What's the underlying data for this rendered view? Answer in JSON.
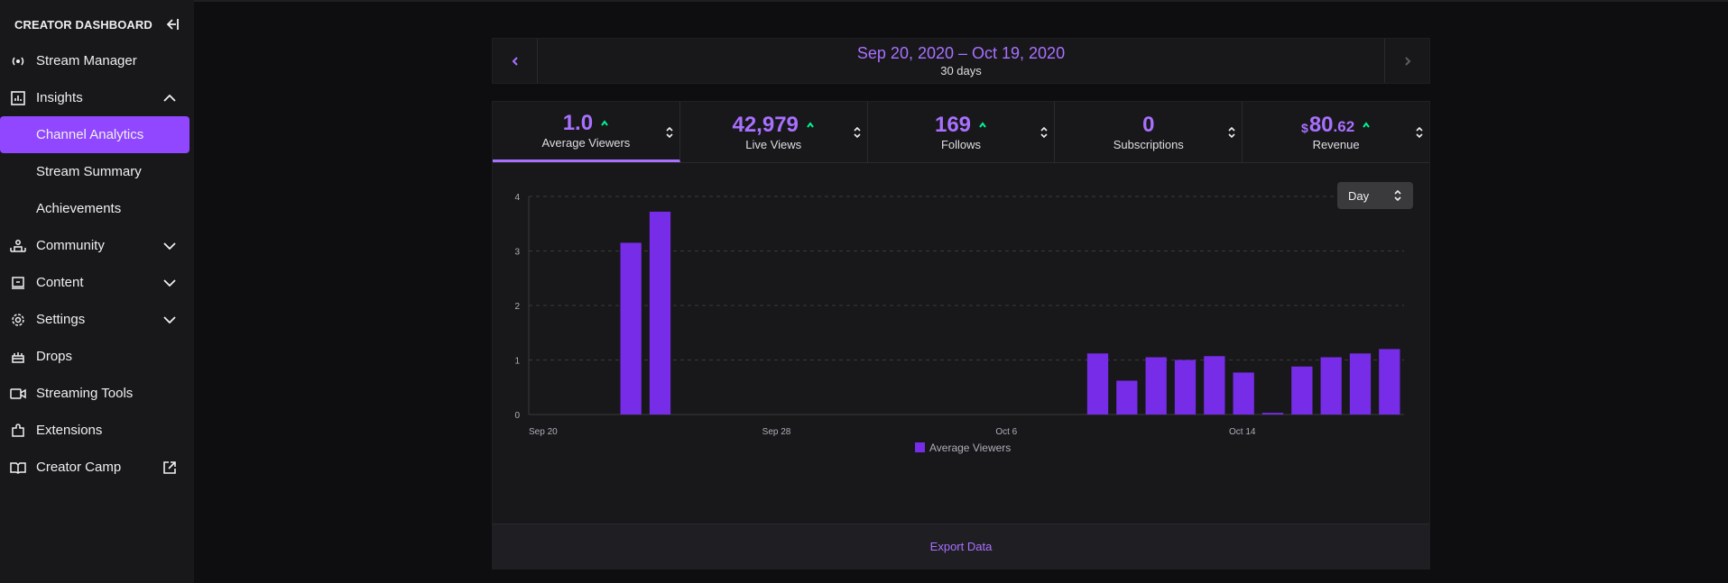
{
  "sidebar": {
    "title": "CREATOR DASHBOARD",
    "items": [
      {
        "label": "Stream Manager",
        "icon": "broadcast-icon"
      },
      {
        "label": "Insights",
        "icon": "insights-icon",
        "chevron": "up"
      },
      {
        "label": "Channel Analytics",
        "sub": true,
        "active": true
      },
      {
        "label": "Stream Summary",
        "sub": true
      },
      {
        "label": "Achievements",
        "sub": true
      },
      {
        "label": "Community",
        "icon": "community-icon",
        "chevron": "down"
      },
      {
        "label": "Content",
        "icon": "content-icon",
        "chevron": "down"
      },
      {
        "label": "Settings",
        "icon": "settings-icon",
        "chevron": "down"
      },
      {
        "label": "Drops",
        "icon": "drops-icon"
      },
      {
        "label": "Streaming Tools",
        "icon": "streaming-tools-icon"
      },
      {
        "label": "Extensions",
        "icon": "extensions-icon"
      },
      {
        "label": "Creator Camp",
        "icon": "creator-camp-icon",
        "external": true
      }
    ]
  },
  "date_range": {
    "label": "Sep 20, 2020 – Oct 19, 2020",
    "days": "30 days"
  },
  "stats": [
    {
      "value": "1.0",
      "label": "Average Viewers",
      "active": true
    },
    {
      "value": "42,979",
      "label": "Live Views"
    },
    {
      "value": "169",
      "label": "Follows"
    },
    {
      "value": "0",
      "label": "Subscriptions",
      "no_arrow": true
    },
    {
      "currency": "$",
      "value": "80",
      "cents": ".62",
      "label": "Revenue"
    }
  ],
  "granularity": "Day",
  "export_label": "Export Data",
  "colors": {
    "accent": "#a970ff",
    "bar": "#772ce8",
    "trend_up": "#00f593",
    "active_nav": "#9147ff"
  },
  "chart_data": {
    "type": "bar",
    "x": [
      "Sep 20",
      "Sep 21",
      "Sep 22",
      "Sep 23",
      "Sep 24",
      "Sep 25",
      "Sep 26",
      "Sep 27",
      "Sep 28",
      "Sep 29",
      "Sep 30",
      "Oct 1",
      "Oct 2",
      "Oct 3",
      "Oct 4",
      "Oct 5",
      "Oct 6",
      "Oct 7",
      "Oct 8",
      "Oct 9",
      "Oct 10",
      "Oct 11",
      "Oct 12",
      "Oct 13",
      "Oct 14",
      "Oct 15",
      "Oct 16",
      "Oct 17",
      "Oct 18",
      "Oct 19"
    ],
    "series": [
      {
        "name": "Average Viewers",
        "values": [
          0,
          0,
          0,
          3.15,
          3.72,
          0,
          0,
          0,
          0,
          0,
          0,
          0,
          0,
          0,
          0,
          0,
          0,
          0,
          0,
          1.12,
          0.62,
          1.05,
          1.0,
          1.07,
          0.77,
          0.03,
          0.88,
          1.05,
          1.12,
          1.2
        ]
      }
    ],
    "x_tick_labels": [
      "Sep 20",
      "Sep 28",
      "Oct 6",
      "Oct 14"
    ],
    "y_ticks": [
      0,
      1,
      2,
      3,
      4
    ],
    "ylim": [
      0,
      4
    ],
    "grid": true,
    "legend": "bottom-center"
  }
}
